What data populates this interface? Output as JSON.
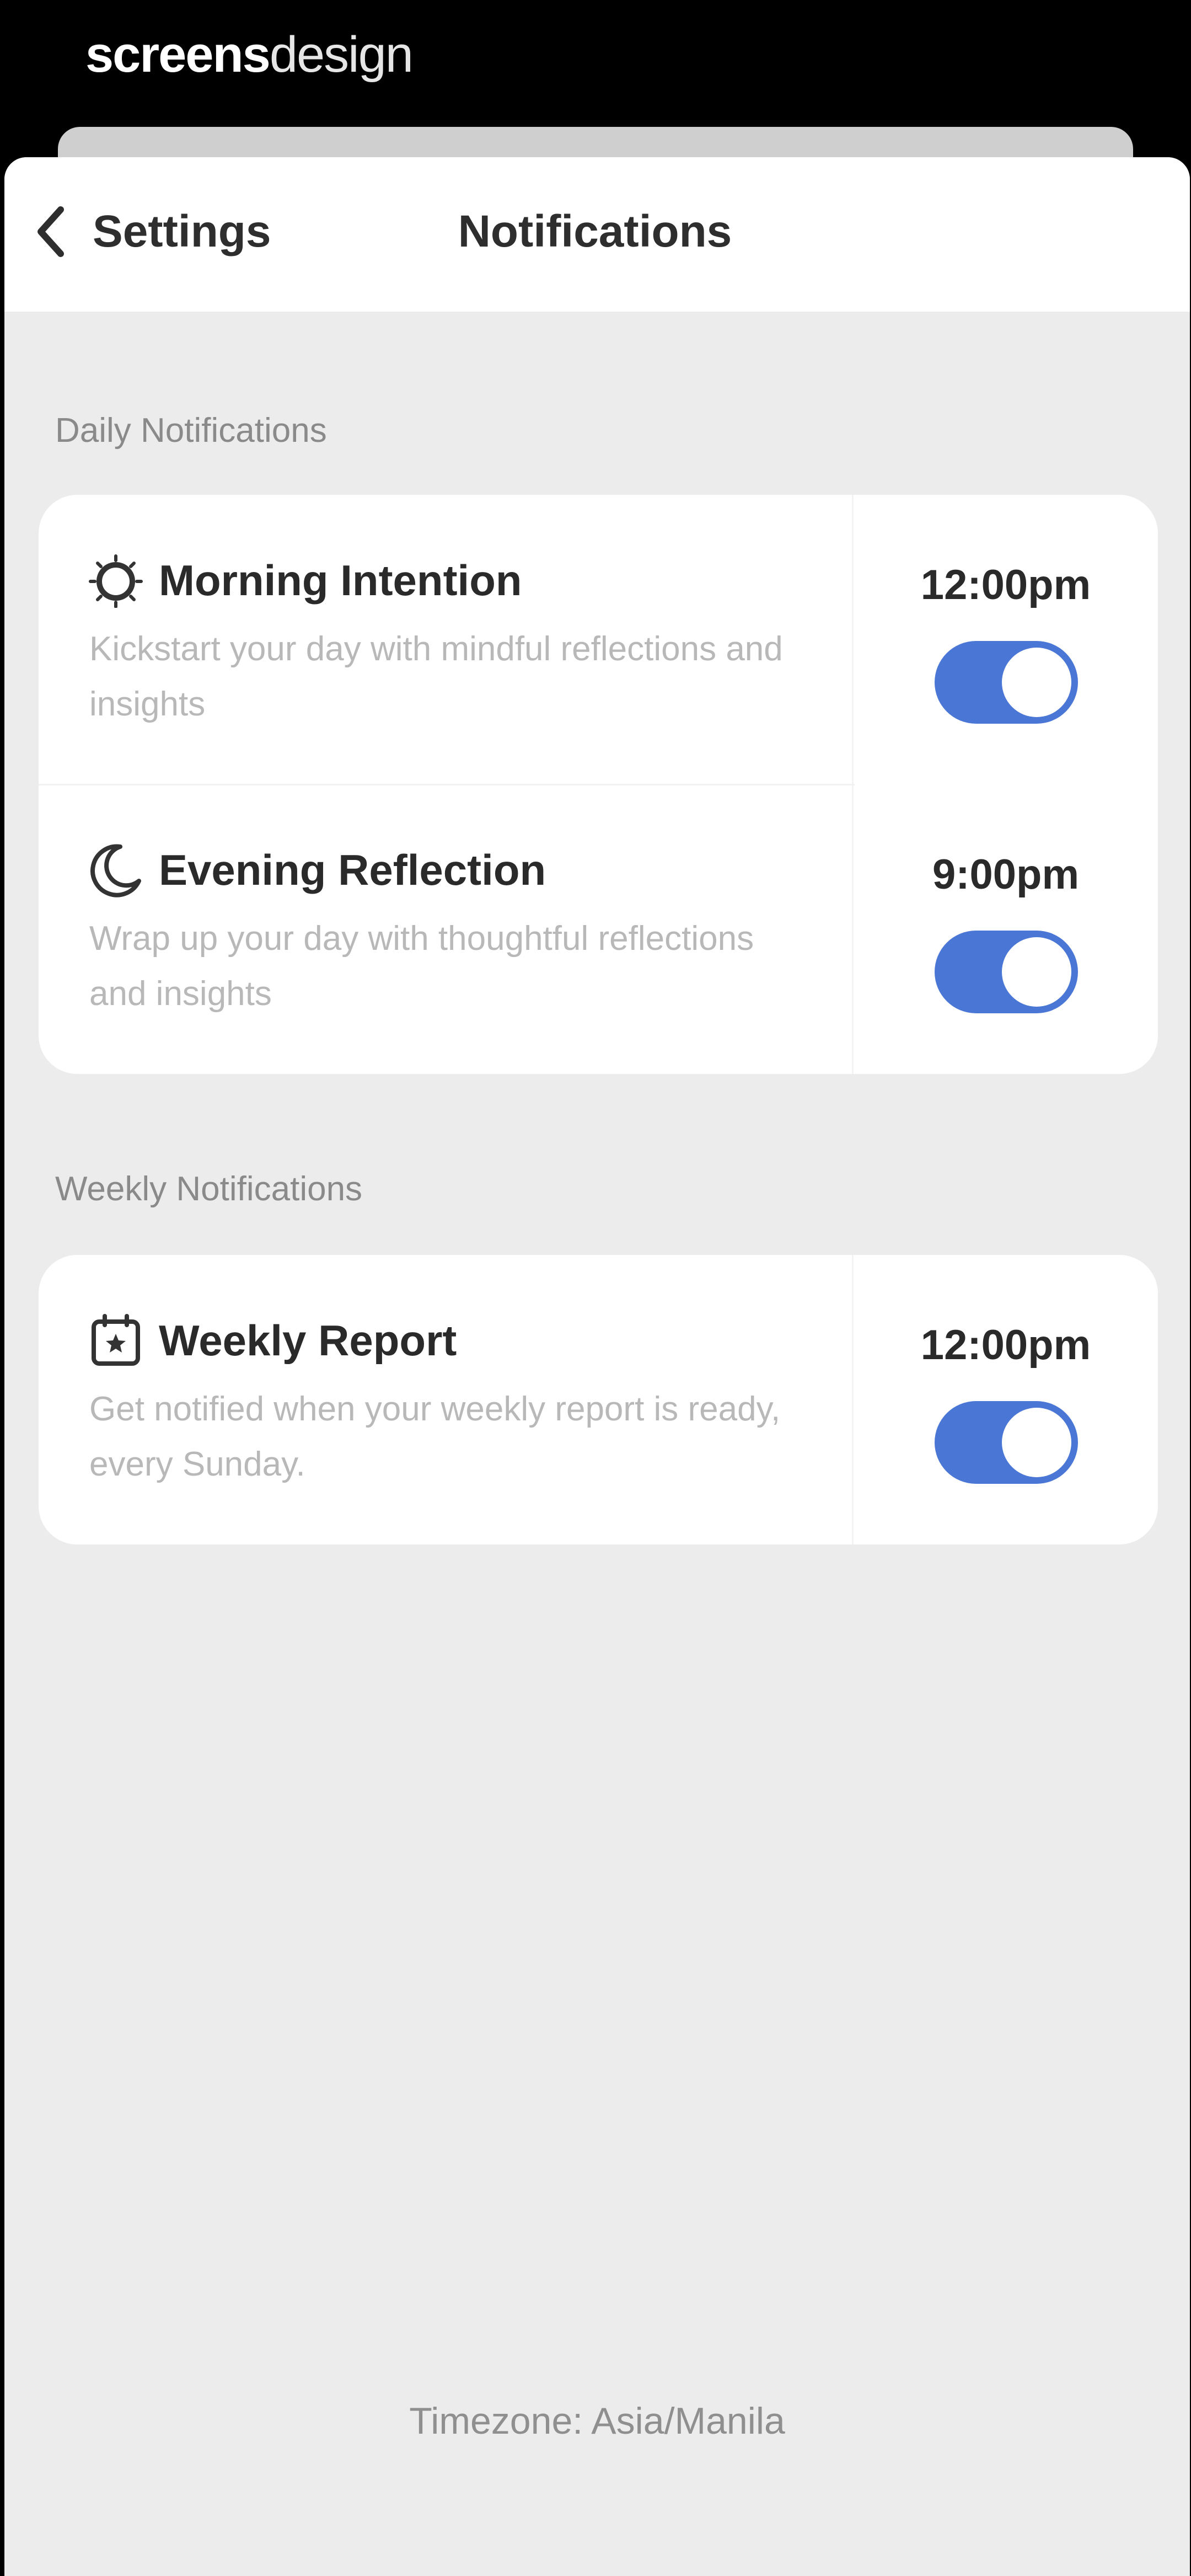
{
  "brand": {
    "part1": "screens",
    "part2": "design"
  },
  "navbar": {
    "back_label": "Settings",
    "title": "Notifications"
  },
  "sections": [
    {
      "label": "Daily Notifications",
      "items": [
        {
          "icon": "sun-icon",
          "title": "Morning Intention",
          "description": "Kickstart your day with mindful reflections and insights",
          "time": "12:00pm",
          "enabled": true
        },
        {
          "icon": "moon-icon",
          "title": "Evening Reflection",
          "description": "Wrap up your day with thoughtful reflections and insights",
          "time": "9:00pm",
          "enabled": true
        }
      ]
    },
    {
      "label": "Weekly Notifications",
      "items": [
        {
          "icon": "calendar-icon",
          "title": "Weekly Report",
          "description": "Get notified when your weekly report is ready, every Sunday.",
          "time": "12:00pm",
          "enabled": true
        }
      ]
    }
  ],
  "footer": {
    "timezone": "Timezone: Asia/Manila"
  },
  "colors": {
    "toggle_on": "#4a76d6",
    "background": "#ececec",
    "card": "#ffffff"
  }
}
